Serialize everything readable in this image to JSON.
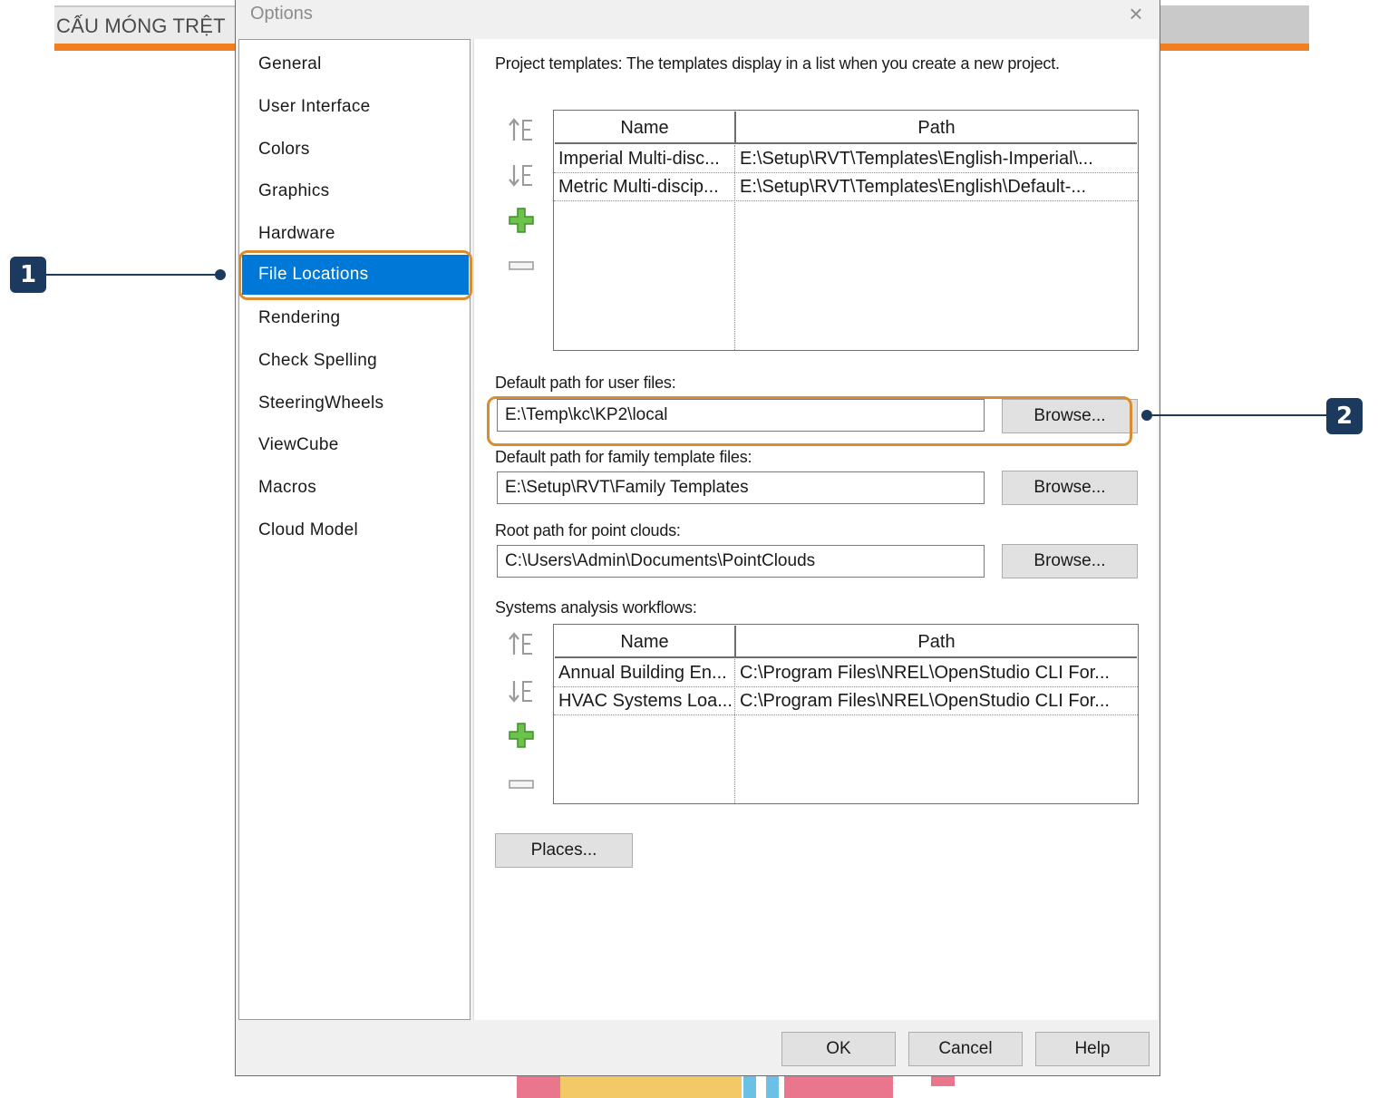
{
  "background": {
    "tab_label": "CẤU MÓNG TRỆT",
    "accent_color": "#f07f22"
  },
  "dialog": {
    "title": "Options",
    "close_icon": "×"
  },
  "nav": {
    "items": [
      {
        "label": "General",
        "active": false
      },
      {
        "label": "User Interface",
        "active": false
      },
      {
        "label": "Colors",
        "active": false
      },
      {
        "label": "Graphics",
        "active": false
      },
      {
        "label": "Hardware",
        "active": false
      },
      {
        "label": "File Locations",
        "active": true
      },
      {
        "label": "Rendering",
        "active": false
      },
      {
        "label": "Check Spelling",
        "active": false
      },
      {
        "label": "SteeringWheels",
        "active": false
      },
      {
        "label": "ViewCube",
        "active": false
      },
      {
        "label": "Macros",
        "active": false
      },
      {
        "label": "Cloud Model",
        "active": false
      }
    ],
    "active_color": "#0078d7"
  },
  "project_templates": {
    "label": "Project templates:  The templates display in a list when you create a new project.",
    "columns": [
      "Name",
      "Path"
    ],
    "rows": [
      [
        "Imperial Multi-disc...",
        "E:\\Setup\\RVT\\Templates\\English-Imperial\\..."
      ],
      [
        "Metric Multi-discip...",
        "E:\\Setup\\RVT\\Templates\\English\\Default-..."
      ]
    ]
  },
  "user_files": {
    "label": "Default path for user files:",
    "value": "E:\\Temp\\kc\\KP2\\local",
    "browse_label": "Browse..."
  },
  "family_templates": {
    "label": "Default path for family template files:",
    "value": "E:\\Setup\\RVT\\Family Templates",
    "browse_label": "Browse..."
  },
  "point_clouds": {
    "label": "Root path for point clouds:",
    "value": "C:\\Users\\Admin\\Documents\\PointClouds",
    "browse_label": "Browse..."
  },
  "systems_analysis": {
    "label": "Systems analysis workflows:",
    "columns": [
      "Name",
      "Path"
    ],
    "rows": [
      [
        "Annual Building En...",
        "C:\\Program Files\\NREL\\OpenStudio CLI For..."
      ],
      [
        "HVAC Systems Loa...",
        "C:\\Program Files\\NREL\\OpenStudio CLI For..."
      ]
    ]
  },
  "places_label": "Places...",
  "footer": {
    "ok": "OK",
    "cancel": "Cancel",
    "help": "Help"
  },
  "callouts": [
    "1",
    "2"
  ],
  "icons": {
    "move_up": "move-up-icon",
    "move_down": "move-down-icon",
    "add": "add-icon",
    "remove": "remove-icon"
  }
}
